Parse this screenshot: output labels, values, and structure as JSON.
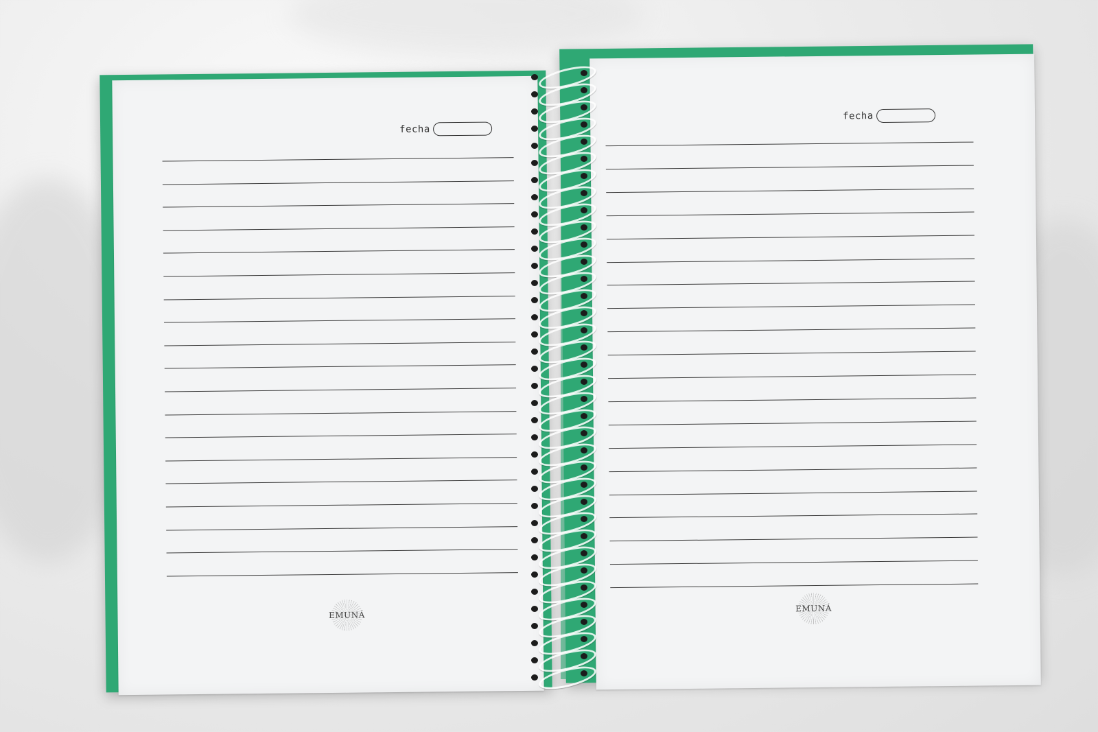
{
  "notebook": {
    "cover_color": "#2fa874",
    "left_page": {
      "date_label": "fecha",
      "brand": "EMUNÁ",
      "rule_count": 19
    },
    "right_page": {
      "date_label": "fecha",
      "brand": "EMUNÁ",
      "rule_count": 20
    },
    "binding": "spiral"
  }
}
